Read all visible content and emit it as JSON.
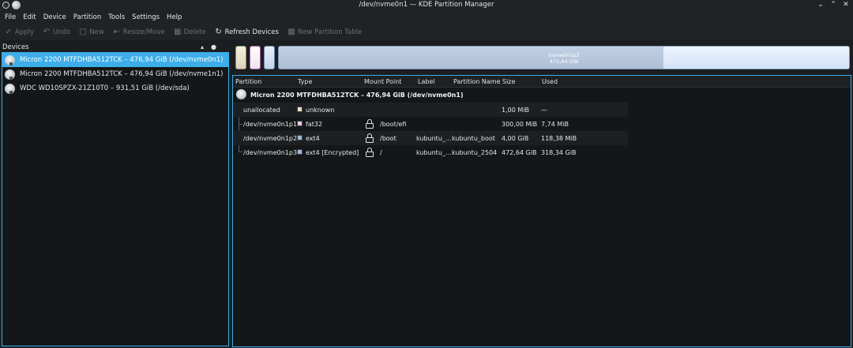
{
  "window": {
    "title": "/dev/nvme0n1 — KDE Partition Manager",
    "controls": [
      "minimize-icon",
      "maximize-icon",
      "close-icon"
    ]
  },
  "menu": [
    "File",
    "Edit",
    "Device",
    "Partition",
    "Tools",
    "Settings",
    "Help"
  ],
  "toolbar": [
    {
      "label": "Apply",
      "icon": "check-icon",
      "enabled": false
    },
    {
      "label": "Undo",
      "icon": "undo-icon",
      "enabled": false
    },
    {
      "label": "New",
      "icon": "new-icon",
      "enabled": false
    },
    {
      "label": "Resize/Move",
      "icon": "resize-icon",
      "enabled": false
    },
    {
      "label": "Delete",
      "icon": "trash-icon",
      "enabled": false
    },
    {
      "label": "Refresh Devices",
      "icon": "refresh-icon",
      "enabled": true
    },
    {
      "label": "New Partition Table",
      "icon": "new-table-icon",
      "enabled": false
    }
  ],
  "devices_panel": {
    "header": "Devices",
    "devices": [
      {
        "label": "Micron 2200 MTFDHBA512TCK – 476,94 GiB (/dev/nvme0n1)",
        "selected": true
      },
      {
        "label": "Micron 2200 MTFDHBA512TCK – 476,94 GiB (/dev/nvme1n1)",
        "selected": false
      },
      {
        "label": "WDC WD10SPZX-21Z10T0 – 931,51 GiB (/dev/sda)",
        "selected": false
      }
    ]
  },
  "partition_bar": {
    "main_label": "nvme0n1p3",
    "main_size": "472,64 GiB",
    "used_fraction": 0.674
  },
  "table": {
    "columns": [
      "Partition",
      "Type",
      "Mount Point",
      "Label",
      "Partition Name",
      "Size",
      "Used"
    ],
    "device_title": "Micron 2200 MTFDHBA512TCK – 476,94 GiB (/dev/nvme0n1)",
    "rows": [
      {
        "partition": "unallocated",
        "type": "unknown",
        "type_color": "#e9e0c0",
        "locked": false,
        "mount": "",
        "label": "",
        "name": "",
        "size": "1,00 MiB",
        "used": "—"
      },
      {
        "partition": "/dev/nvme0n1p1",
        "type": "fat32",
        "type_color": "#e9c9e9",
        "locked": true,
        "mount": "/boot/efi",
        "label": "",
        "name": "",
        "size": "300,00 MiB",
        "used": "7,74 MiB"
      },
      {
        "partition": "/dev/nvme0n1p2",
        "type": "ext4",
        "type_color": "#9fb7da",
        "locked": true,
        "mount": "/boot",
        "label": "kubuntu_...",
        "name": "kubuntu_boot",
        "size": "4,00 GiB",
        "used": "118,38 MiB"
      },
      {
        "partition": "/dev/nvme0n1p3",
        "type": "ext4 [Encrypted]",
        "type_color": "#9fb7da",
        "locked": true,
        "mount": "/",
        "label": "kubuntu_...",
        "name": "kubuntu_2504",
        "size": "472,64 GiB",
        "used": "318,34 GiB"
      }
    ]
  }
}
